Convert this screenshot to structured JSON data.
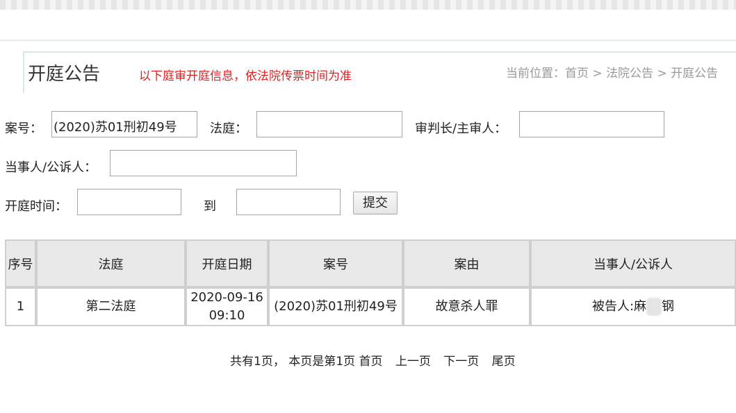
{
  "header": {
    "title": "开庭公告",
    "notice": "以下庭审开庭信息，依法院传票时间为准",
    "breadcrumb_prefix": "当前位置：",
    "breadcrumb": [
      "首页",
      "法院公告",
      "开庭公告"
    ],
    "breadcrumb_sep": ">"
  },
  "form": {
    "case_no_label": "案号：",
    "case_no_value": "(2020)苏01刑初49号",
    "court_label": "法庭：",
    "court_value": "",
    "judge_label": "审判长/主审人：",
    "judge_value": "",
    "party_label": "当事人/公诉人：",
    "party_value": "",
    "time_label": "开庭时间：",
    "time_from": "",
    "to_label": "到",
    "time_to": "",
    "submit_label": "提交"
  },
  "table": {
    "columns": [
      "序号",
      "法庭",
      "开庭日期",
      "案号",
      "案由",
      "当事人/公诉人"
    ],
    "rows": [
      {
        "index": "1",
        "court": "第二法庭",
        "date": "2020-09-16",
        "time": "09:10",
        "case_no": "(2020)苏01刑初49号",
        "cause": "故意杀人罪",
        "party_prefix": "被告人:麻",
        "party_suffix": "钢"
      }
    ]
  },
  "pager": {
    "summary": "共有1页， 本页是第1页",
    "first": "首页",
    "prev": "上一页",
    "next": "下一页",
    "last": "尾页"
  }
}
